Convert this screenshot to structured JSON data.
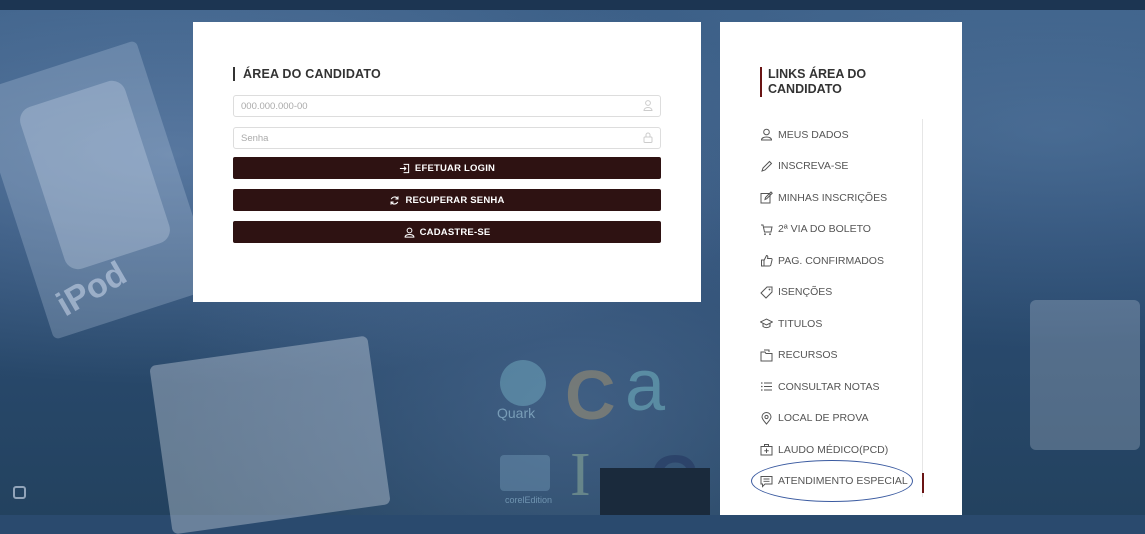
{
  "login": {
    "title": "ÁREA DO CANDIDATO",
    "cpf_placeholder": "000.000.000-00",
    "password_placeholder": "Senha",
    "login_button": "EFETUAR LOGIN",
    "recover_button": "RECUPERAR SENHA",
    "register_button": "CADASTRE-SE"
  },
  "links": {
    "title_line1": "LINKS ÁREA DO",
    "title_line2": "CANDIDATO",
    "items": [
      {
        "label": "MEUS DADOS",
        "icon": "user-icon"
      },
      {
        "label": "INSCREVA-SE",
        "icon": "pencil-icon"
      },
      {
        "label": "MINHAS INSCRIÇÕES",
        "icon": "edit-icon"
      },
      {
        "label": "2ª VIA DO BOLETO",
        "icon": "cart-icon"
      },
      {
        "label": "PAG. CONFIRMADOS",
        "icon": "thumbs-up-icon"
      },
      {
        "label": "ISENÇÕES",
        "icon": "tag-icon"
      },
      {
        "label": "TITULOS",
        "icon": "graduation-cap-icon"
      },
      {
        "label": "RECURSOS",
        "icon": "folder-icon"
      },
      {
        "label": "CONSULTAR NOTAS",
        "icon": "list-icon"
      },
      {
        "label": "LOCAL DE PROVA",
        "icon": "map-pin-icon"
      },
      {
        "label": "LAUDO MÉDICO(PCD)",
        "icon": "medical-kit-icon"
      },
      {
        "label": "ATENDIMENTO ESPECIAL",
        "icon": "chat-icon"
      }
    ]
  },
  "background": {
    "ipod_text": "iPod",
    "logo_quark": "Quark",
    "logo_edition": "corelEdition"
  },
  "colors": {
    "button_bg": "#2e1212",
    "accent": "#6a1414",
    "highlight_ellipse": "#3a5aa0"
  }
}
